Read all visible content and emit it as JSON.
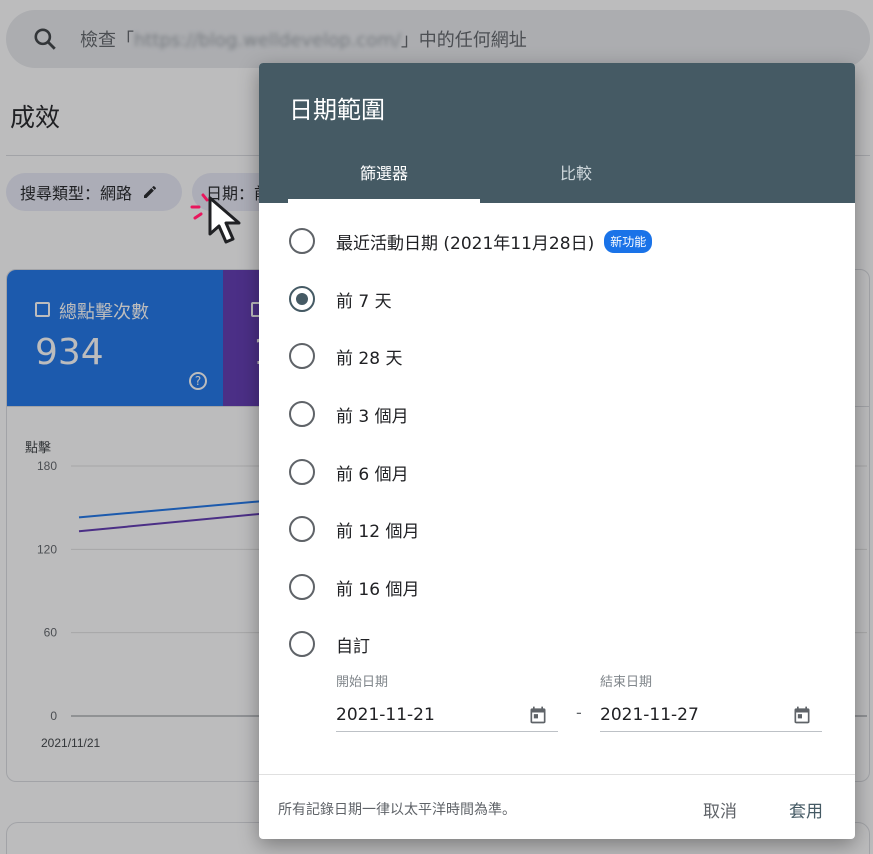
{
  "search": {
    "prefix": "檢查「",
    "url": "https://blog.welldevelop.com/",
    "suffix": "」中的任何網址"
  },
  "page": {
    "title": "成效"
  },
  "filters": {
    "search_type": "搜尋類型：網路",
    "date": "日期：前"
  },
  "cards": {
    "clicks": {
      "label": "總點擊次數",
      "value": "934",
      "help": "?"
    },
    "impressions": {
      "value": "1"
    }
  },
  "chart_data": {
    "type": "line",
    "ylabel": "點擊",
    "y_ticks": [
      "180",
      "120",
      "60",
      "0"
    ],
    "ylim": [
      0,
      180
    ],
    "x_tick_first": "2021/11/21",
    "series": [
      {
        "color": "#1a73e8",
        "values": [
          143,
          155
        ]
      },
      {
        "color": "#5e35b1",
        "values": [
          133,
          146
        ]
      }
    ]
  },
  "dialog": {
    "title": "日期範圍",
    "tabs": {
      "filter": "篩選器",
      "compare": "比較"
    },
    "options": [
      {
        "label": "最近活動日期 (2021年11月28日)",
        "badge": "新功能",
        "selected": false
      },
      {
        "label": "前 7 天",
        "selected": true
      },
      {
        "label": "前 28 天",
        "selected": false
      },
      {
        "label": "前 3 個月",
        "selected": false
      },
      {
        "label": "前 6 個月",
        "selected": false
      },
      {
        "label": "前 12 個月",
        "selected": false
      },
      {
        "label": "前 16 個月",
        "selected": false
      },
      {
        "label": "自訂",
        "selected": false
      }
    ],
    "start": {
      "label": "開始日期",
      "value": "2021-11-21"
    },
    "end": {
      "label": "結束日期",
      "value": "2021-11-27"
    },
    "dash": "-",
    "footnote": "所有記錄日期一律以太平洋時間為準。",
    "cancel": "取消",
    "apply": "套用"
  },
  "colors": {
    "dialog_header": "#455a64",
    "clicks_card": "#1a73e8",
    "impressions_card": "#5e35b1",
    "cursor_accent": "#e8175d"
  }
}
